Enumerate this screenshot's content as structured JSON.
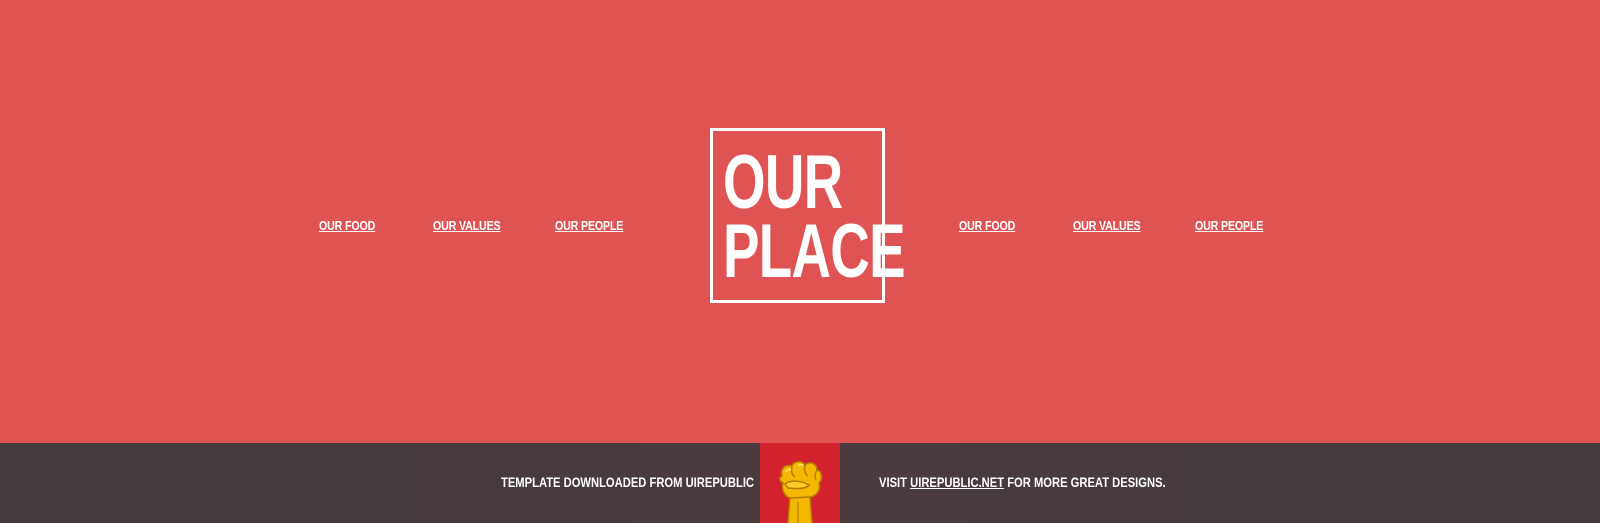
{
  "header": {
    "left_nav": [
      {
        "label": "OUR FOOD"
      },
      {
        "label": "OUR VALUES"
      },
      {
        "label": "OUR PEOPLE"
      }
    ],
    "right_nav": [
      {
        "label": "OUR FOOD"
      },
      {
        "label": "OUR VALUES"
      },
      {
        "label": "OUR PEOPLE"
      }
    ],
    "logo": {
      "line1": "OUR",
      "line2": "PLACE"
    }
  },
  "footer": {
    "left_text": "TEMPLATE DOWNLOADED FROM UIREPUBLIC",
    "right_prefix": "VISIT ",
    "right_link": "UIREPUBLIC.NET",
    "right_suffix": " FOR MORE GREAT DESIGNS.",
    "badge_icon": "raised-fist-icon"
  },
  "colors": {
    "hero_background": "#df5452",
    "footer_background": "#433b3f",
    "badge_background": "#d3222e",
    "fist": "#f5b800",
    "text": "#ffffff"
  }
}
